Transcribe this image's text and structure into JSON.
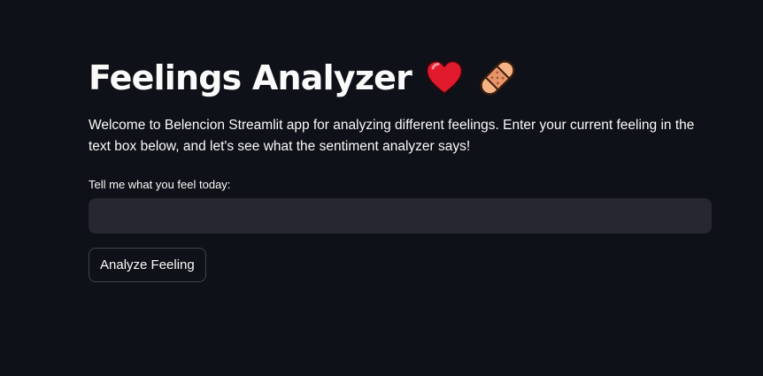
{
  "app": {
    "title": "Feelings Analyzer",
    "title_icons": [
      "heart-emoji",
      "bandage-emoji"
    ],
    "intro": "Welcome to Belencion Streamlit app for analyzing different feelings. Enter your current feeling in the text box below, and let's see what the sentiment analyzer says!"
  },
  "form": {
    "input_label": "Tell me what you feel today:",
    "input_value": "",
    "button_label": "Analyze Feeling"
  },
  "colors": {
    "background": "#0e1117",
    "input_background": "#262730",
    "text": "#fafafa",
    "heart": "#e0192d",
    "bandage": "#f3a874"
  }
}
